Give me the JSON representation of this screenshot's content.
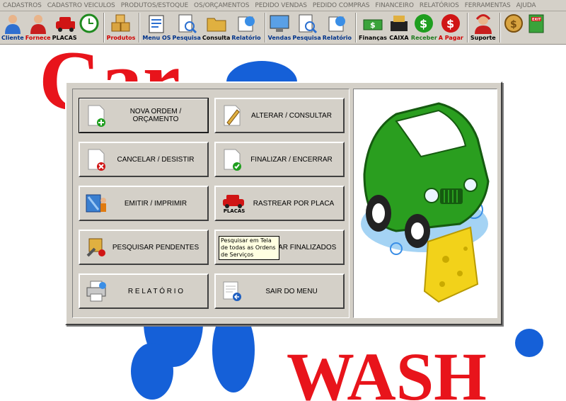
{
  "menubar": {
    "items": [
      "CADASTROS",
      "CADASTRO VEICULOS",
      "PRODUTOS/ESTOQUE",
      "OS/ORÇAMENTOS",
      "PEDIDO VENDAS",
      "PEDIDO COMPRAS",
      "FINANCEIRO",
      "RELATÓRIOS",
      "FERRAMENTAS",
      "AJUDA"
    ]
  },
  "toolbar": {
    "cliente": "Cliente",
    "fornece": "Fornece",
    "placas": "PLACAS",
    "produtos": "Produtos",
    "menu_os": "Menu OS",
    "pesquisa_os": "Pesquisa",
    "consulta": "Consulta",
    "relatorio_os": "Relatório",
    "vendas": "Vendas",
    "pesquisa_vendas": "Pesquisa",
    "relatorio_vendas": "Relatório",
    "financas": "Finanças",
    "caixa": "CAIXA",
    "receber": "Receber",
    "a_pagar": "A Pagar",
    "suporte": "Suporte",
    "exit_icon_text": "EXIT"
  },
  "logo": {
    "top_word": "Car",
    "bottom_word": "WASH"
  },
  "dialog": {
    "buttons": {
      "nova_ordem": "NOVA ORDEM / ORÇAMENTO",
      "alterar": "ALTERAR / CONSULTAR",
      "cancelar": "CANCELAR / DESISTIR",
      "finalizar": "FINALIZAR / ENCERRAR",
      "emitir": "EMITIR / IMPRIMIR",
      "rastrear": "RASTREAR POR PLACA",
      "rastrear_icon_text": "PLACAS",
      "pesquisar_pendentes": "PESQUISAR PENDENTES",
      "pesquisar_finalizados": "PESQUISAR FINALIZADOS",
      "relatorio": "R E L A T Ó R I O",
      "sair": "SAIR DO MENU"
    },
    "tooltip": "Pesquisar em Tela de todas as Ordens de Serviços"
  },
  "colors": {
    "window_bg": "#d4d0c8",
    "logo_red": "#e8141b",
    "logo_blue": "#1560d8",
    "car_green": "#2a9e1f",
    "toolbar_label_blue": "#00338a",
    "toolbar_label_red": "#d00000"
  }
}
